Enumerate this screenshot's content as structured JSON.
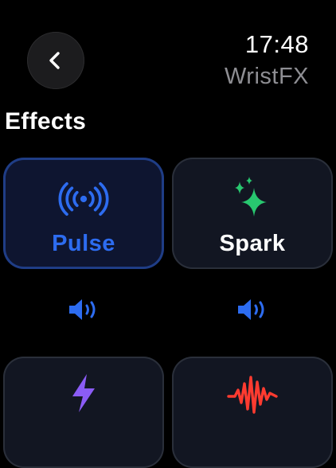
{
  "status": {
    "time": "17:48",
    "app_name": "WristFX"
  },
  "section": {
    "title": "Effects"
  },
  "effects": [
    {
      "label": "Pulse",
      "icon": "haptic-pulse-icon",
      "selected": true,
      "color": "#2d6cf0"
    },
    {
      "label": "Spark",
      "icon": "sparkles-icon",
      "selected": false,
      "color": "#28c76f"
    },
    {
      "label": "",
      "icon": "lightning-bolt-icon",
      "selected": false,
      "color": "#8b5cf6"
    },
    {
      "label": "",
      "icon": "waveform-icon",
      "selected": false,
      "color": "#ff3b30"
    }
  ],
  "accent": "#2d6cf0"
}
